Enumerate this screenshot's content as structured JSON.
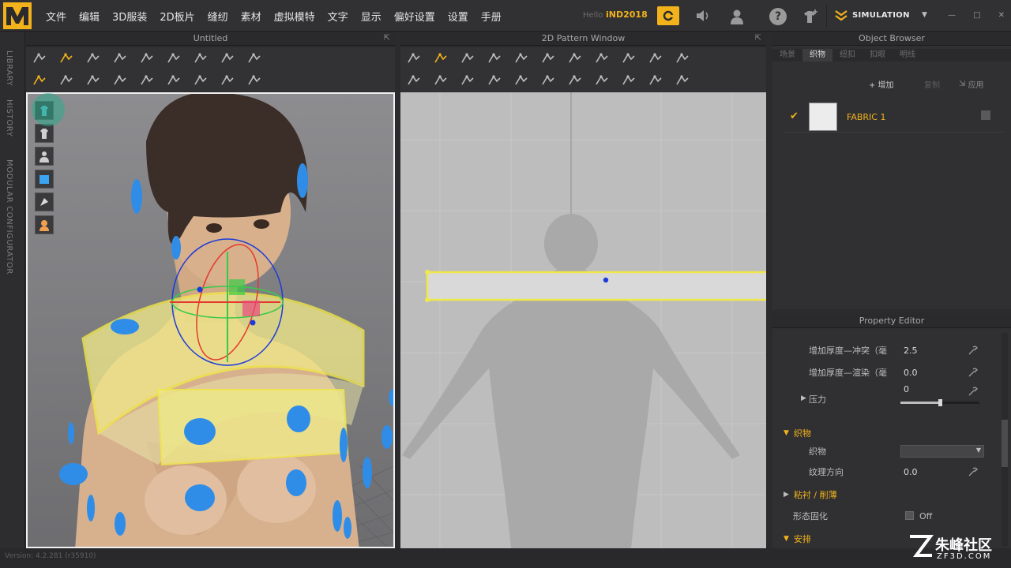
{
  "menubar": {
    "items": [
      "文件",
      "编辑",
      "3D服装",
      "2D板片",
      "缝纫",
      "素材",
      "虚拟模特",
      "文字",
      "显示",
      "偏好设置",
      "设置",
      "手册"
    ],
    "hello": "Hello",
    "user": "iND2018",
    "simulation_label": "SIMULATION"
  },
  "sidebar": {
    "tabs": [
      "LIBRARY",
      "HISTORY",
      "MODULAR CONFIGURATOR"
    ]
  },
  "viewport3d": {
    "title": "Untitled"
  },
  "pattern2d": {
    "title": "2D Pattern Window"
  },
  "object_browser": {
    "title": "Object Browser",
    "tabs": [
      "场景",
      "织物",
      "纽扣",
      "扣眼",
      "明线"
    ],
    "active_tab": "织物",
    "add_label": "+ 增加",
    "copy_label": "复制",
    "apply_label": "应用",
    "fabric_name": "FABRIC 1"
  },
  "property_editor": {
    "title": "Property Editor",
    "rows": [
      {
        "label": "增加厚度—冲突（毫",
        "value": "2.5"
      },
      {
        "label": "增加厚度—渲染（毫",
        "value": "0.0"
      }
    ],
    "pressure_label": "压力",
    "pressure_value": "0",
    "fabric_section": "织物",
    "fabric_field": "织物",
    "grain_label": "纹理方向",
    "grain_value": "0.0",
    "bond_section": "粘衬 / 削薄",
    "shape_label": "形态固化",
    "shape_value": "Off",
    "arrange_section": "安排"
  },
  "status": {
    "version": "Version: 4.2.281 (r35910)"
  },
  "watermark": {
    "text": "朱峰社区",
    "url": "ZF3D.COM"
  },
  "colors": {
    "accent": "#f2b21c",
    "pattern_outline": "#f0e84a",
    "button_blue": "#2f8de8"
  }
}
